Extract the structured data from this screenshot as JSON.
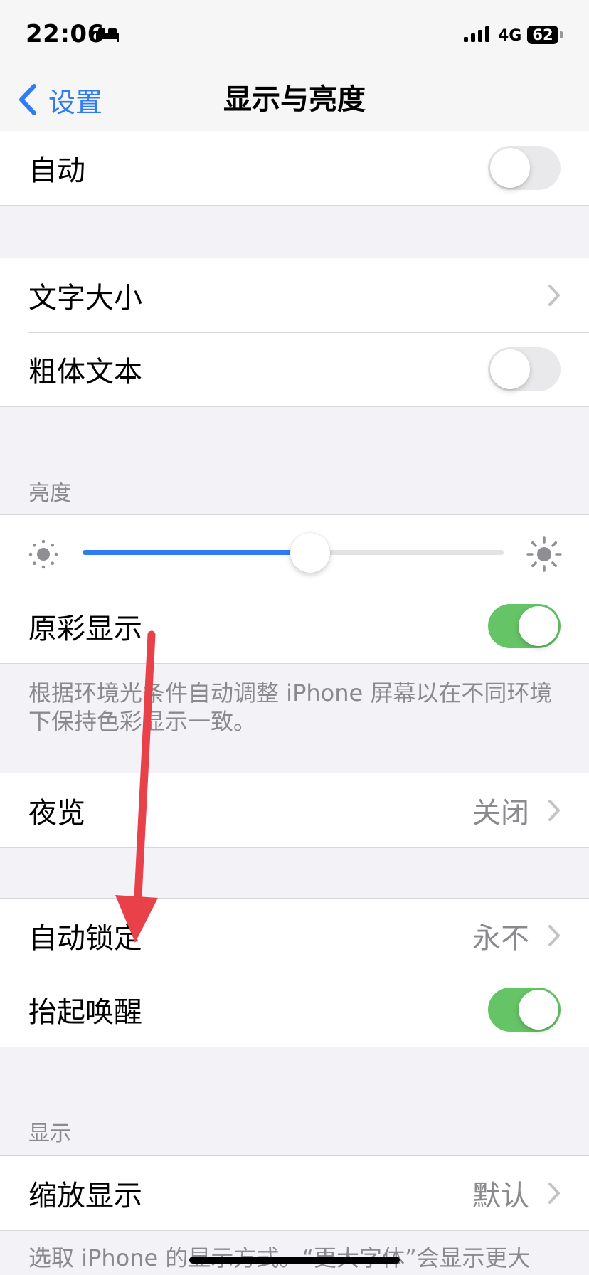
{
  "status_bar": {
    "time": "22:06",
    "network": "4G",
    "battery": "62"
  },
  "nav": {
    "back_label": "设置",
    "title": "显示与亮度"
  },
  "group_auto": {
    "label": "自动",
    "toggle_on": false
  },
  "group_text": {
    "text_size_label": "文字大小",
    "bold_text_label": "粗体文本",
    "bold_toggle_on": false
  },
  "brightness": {
    "header": "亮度",
    "level": 0.54,
    "true_tone_label": "原彩显示",
    "true_tone_on": true,
    "footer": "根据环境光条件自动调整 iPhone 屏幕以在不同环境下保持色彩显示一致。"
  },
  "night_shift": {
    "label": "夜览",
    "value": "关闭"
  },
  "lock": {
    "auto_lock_label": "自动锁定",
    "auto_lock_value": "永不",
    "raise_to_wake_label": "抬起唤醒",
    "raise_to_wake_on": true
  },
  "display": {
    "header": "显示",
    "zoom_label": "缩放显示",
    "zoom_value": "默认",
    "footer": "选取 iPhone 的显示方式。“更大字体”会显示更大"
  },
  "colors": {
    "accent": "#2f7cf6",
    "toggle_on": "#65c466",
    "annotation": "#e8414a"
  }
}
